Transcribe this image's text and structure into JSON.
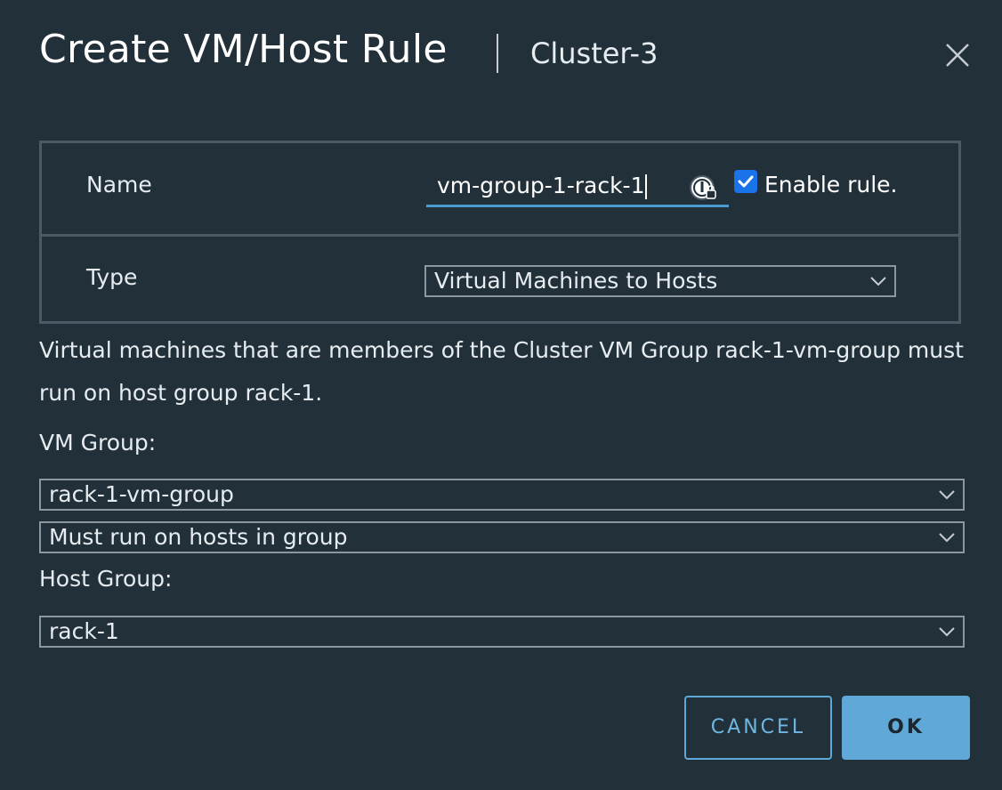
{
  "dialog": {
    "title": "Create VM/Host Rule",
    "subtitle": "Cluster-3",
    "close_icon": "close-icon"
  },
  "form": {
    "name_label": "Name",
    "name_value": "vm-group-1-rack-1",
    "password_icon": "password-manager-icon",
    "enable_checked": true,
    "enable_label": "Enable rule.",
    "type_label": "Type",
    "type_value": "Virtual Machines to Hosts"
  },
  "description": "Virtual machines that are members of the Cluster VM Group rack-1-vm-group must run on host group rack-1.",
  "vm_group": {
    "label": "VM Group:",
    "value": "rack-1-vm-group"
  },
  "relation": {
    "value": "Must run on hosts in group"
  },
  "host_group": {
    "label": "Host Group:",
    "value": "rack-1"
  },
  "buttons": {
    "cancel": "CANCEL",
    "ok": "OK"
  },
  "colors": {
    "background": "#22303a",
    "accent": "#5fa8d8",
    "checkbox": "#1a73e8",
    "input_underline": "#4a9ad4"
  }
}
